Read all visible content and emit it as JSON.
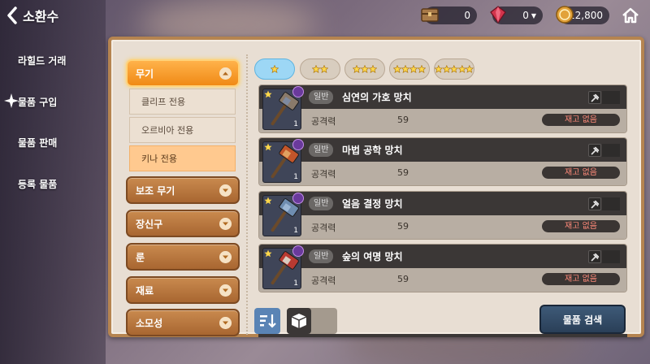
{
  "header": {
    "title": "소환수",
    "currencies": [
      {
        "icon": "treasure-chest-icon",
        "value": "0"
      },
      {
        "icon": "red-gem-icon",
        "value": "0"
      },
      {
        "icon": "gold-coin-icon",
        "value": "12,800"
      }
    ]
  },
  "sidebar": {
    "items": [
      {
        "label": "라힐드 거래"
      },
      {
        "label": "물품 구입"
      },
      {
        "label": "물품 판매"
      },
      {
        "label": "등록 물품"
      }
    ]
  },
  "categories": {
    "weapon": "무기",
    "weapon_subs": [
      "클리프 전용",
      "오르비아 전용",
      "키나 전용"
    ],
    "others": [
      "보조 무기",
      "장신구",
      "룬",
      "재료",
      "소모성"
    ]
  },
  "star_tabs": [
    1,
    2,
    3,
    4,
    5
  ],
  "items": [
    {
      "grade": "일반",
      "name": "심연의 가호 망치",
      "stat_label": "공격력",
      "stat_value": "59",
      "stock": "재고 없음",
      "count": "1",
      "colors": [
        "#8a7a6a",
        "#7e8aa0"
      ]
    },
    {
      "grade": "일반",
      "name": "마법 공학 망치",
      "stat_label": "공격력",
      "stat_value": "59",
      "stock": "재고 없음",
      "count": "1",
      "colors": [
        "#c2552a",
        "#e0a060"
      ]
    },
    {
      "grade": "일반",
      "name": "얼음 결정 망치",
      "stat_label": "공격력",
      "stat_value": "59",
      "stock": "재고 없음",
      "count": "1",
      "colors": [
        "#6f8db0",
        "#9cb6d4"
      ]
    },
    {
      "grade": "일반",
      "name": "숲의 여명 망치",
      "stat_label": "공격력",
      "stat_value": "59",
      "stock": "재고 없음",
      "count": "1",
      "colors": [
        "#b83a32",
        "#d8ccc0"
      ]
    }
  ],
  "search_button": "물품 검색"
}
